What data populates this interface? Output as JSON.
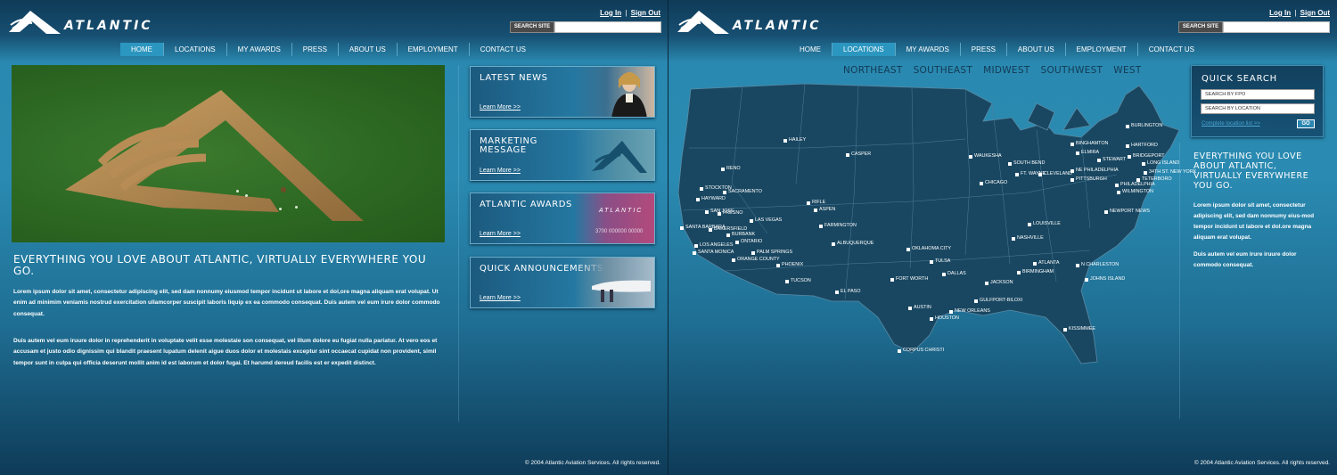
{
  "brand": {
    "name": "ATLANTIC"
  },
  "header": {
    "login": "Log In",
    "separator": "|",
    "signout": "Sign Out",
    "search_button": "SEARCH SITE",
    "search_value": ""
  },
  "nav": [
    "HOME",
    "LOCATIONS",
    "MY AWARDS",
    "PRESS",
    "ABOUT US",
    "EMPLOYMENT",
    "CONTACT US"
  ],
  "home": {
    "active_nav": "HOME",
    "headline": "EVERYTHING YOU LOVE ABOUT ATLANTIC, VIRTUALLY EVERYWHERE YOU GO.",
    "paragraphs": [
      "Lorem ipsum dolor sit amet, consectetur adipiscing elit, sed dam nonnumy eiusmod tempor incidunt ut labore et dol,ore magna aliquam erat volupat. Ut enim ad minimim veniamis nostrud exercitation ullamcorper suscipit laboris liquip ex ea commodo consequat. Duis autem vel eum irure dolor commodo consequat.",
      "Duis autem vel eum iruure dolor in reprehenderit in voluptate velit esse molestaie son consequat, vel illum dolore eu fugiat nulla pariatur. At vero eos et accusam et justo odio dignissim qui blandit praesent lupatum delenit aigue duos dolor et molestais exceptur sint occaecat cupidat non provident, simil tempor sunt in culpa qui officia deserunt mollit anim id est laborum et dolor fugai. Et harumd dereud facilis est er expedit distinct."
    ],
    "cards": [
      {
        "title": "LATEST NEWS",
        "link": "Learn More >>"
      },
      {
        "title": "MARKETING MESSAGE",
        "link": "Learn More >>"
      },
      {
        "title": "ATLANTIC AWARDS",
        "link": "Learn More >>",
        "card_art_text": "ATLANTIC",
        "card_art_number": "3700 000000 00000"
      },
      {
        "title": "QUICK ANNOUNCEMENTS",
        "link": "Learn More >>"
      }
    ],
    "copyright": "© 2004 Atlantic Aviation Services. All rights reserved."
  },
  "locations": {
    "active_nav": "LOCATIONS",
    "regions": [
      "NORTHEAST",
      "SOUTHEAST",
      "MIDWEST",
      "SOUTHWEST",
      "WEST"
    ],
    "cities": [
      "BURLINGTON",
      "HARTFORD",
      "BINGHAMTON",
      "ELMIRA",
      "STEWART",
      "BRIDGEPORT",
      "LONG ISLAND",
      "34TH ST. NEW YORK",
      "TETERBORO",
      "NE PHILADELPHIA",
      "PHILADELPHIA",
      "WILMINGTON",
      "PITTSBURGH",
      "CLEVELAND",
      "FT. WAYNE",
      "SOUTH BEND",
      "WAUKESHA",
      "CHICAGO",
      "NEWPORT NEWS",
      "LOUISVILLE",
      "NASHVILLE",
      "ATLANTA",
      "N CHARLESTON",
      "JOHNS ISLAND",
      "BIRMINGHAM",
      "JACKSON",
      "GULFPORT-BILOXI",
      "NEW ORLEANS",
      "KISSIMMEE",
      "HOUSTON",
      "AUSTIN",
      "CORPUS CHRISTI",
      "DALLAS",
      "FORT WORTH",
      "TULSA",
      "OKLAHOMA CITY",
      "EL PASO",
      "ALBUQUERQUE",
      "FARMINGTON",
      "RIFLE",
      "ASPEN",
      "CASPER",
      "HAILEY",
      "RENO",
      "STOCKTON",
      "SACRAMENTO",
      "HAYWARD",
      "SAN JOSE",
      "FRESNO",
      "BAKERSFIELD",
      "LAS VEGAS",
      "SANTA BARBARA",
      "BURBANK",
      "ONTARIO",
      "LOS ANGELES",
      "SANTA MONICA",
      "PALM SPRINGS",
      "ORANGE COUNTY",
      "PHOENIX",
      "TUCSON"
    ],
    "quick_search": {
      "title": "QUICK SEARCH",
      "field1": "SEARCH BY FPO",
      "field2": "SEARCH BY LOCATION",
      "link": "Complete location list >>",
      "go": "GO"
    },
    "headline": "EVERYTHING YOU LOVE ABOUT ATLANTIC, VIRTUALLY EVERYWHERE YOU GO.",
    "paragraphs": [
      "Lorem ipsum dolor sit amet, consectetur adipiscing elit, sed dam nonnumy eius-mod tempor incidunt ut labore et dol.ore magna aliquam erat volupat.",
      "Duis autem vel eum irure iruure dolor commodo consequat."
    ],
    "copyright": "© 2004 Atlantic Aviation Services. All rights reserved."
  }
}
